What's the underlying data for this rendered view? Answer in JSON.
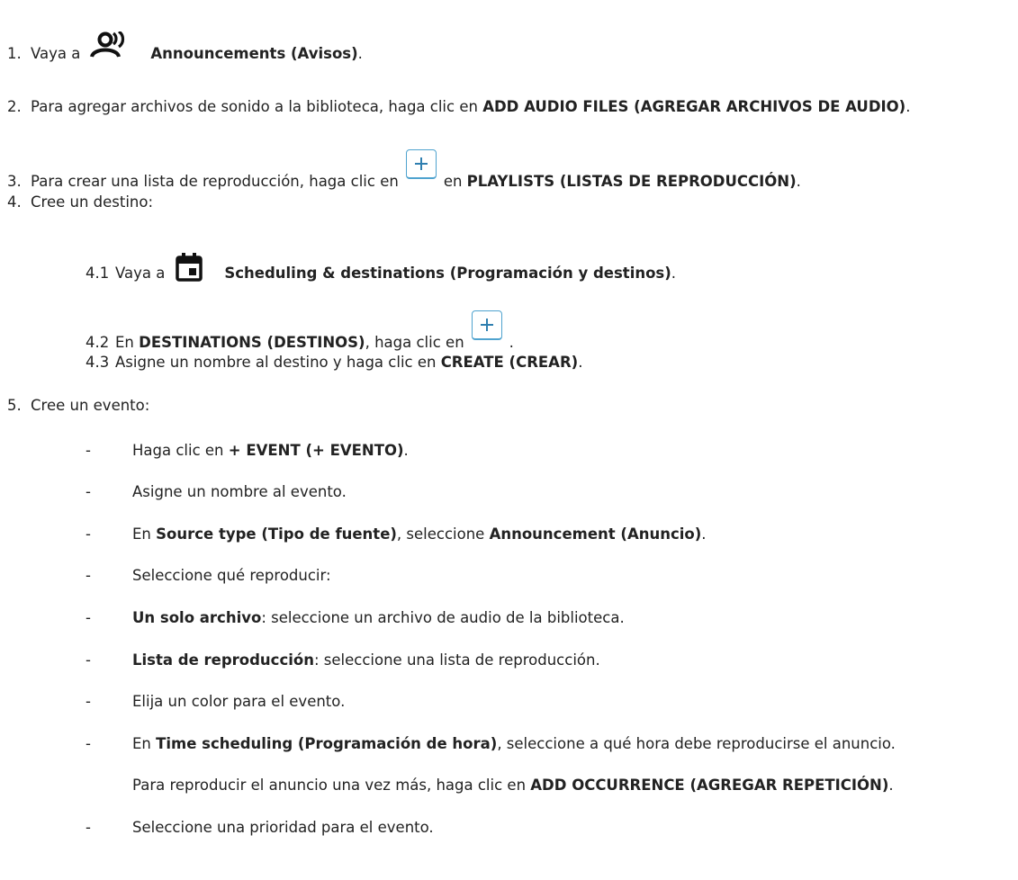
{
  "steps": {
    "s1": {
      "num": "1.",
      "pre": "Vaya a",
      "bold": "Announcements (Avisos)",
      "post": "."
    },
    "s2": {
      "num": "2.",
      "pre": "Para agregar archivos de sonido a la biblioteca, haga clic en ",
      "bold": "ADD AUDIO FILES (AGREGAR ARCHIVOS DE AUDIO)",
      "post": "."
    },
    "s3": {
      "num": "3.",
      "pre": "Para crear una lista de reproducción, haga clic en",
      "mid": "en ",
      "bold": "PLAYLISTS (LISTAS DE REPRODUCCIÓN)",
      "post": "."
    },
    "s4": {
      "num": "4.",
      "text": "Cree un destino:"
    },
    "s4_1": {
      "num": "4.1",
      "pre": "Vaya a",
      "bold": "Scheduling & destinations (Programación y destinos)",
      "post": "."
    },
    "s4_2": {
      "num": "4.2",
      "pre": "En ",
      "bold": "DESTINATIONS (DESTINOS)",
      "mid": ", haga clic en",
      "post": "."
    },
    "s4_3": {
      "num": "4.3",
      "pre": "Asigne un nombre al destino y haga clic en ",
      "bold": "CREATE (CREAR)",
      "post": "."
    },
    "s5": {
      "num": "5.",
      "text": "Cree un evento:"
    }
  },
  "bullets": {
    "dash": "-",
    "b1": {
      "pre": "Haga clic en ",
      "bold": "+ EVENT (+ EVENTO)",
      "post": "."
    },
    "b2": {
      "text": "Asigne un nombre al evento."
    },
    "b3": {
      "pre": "En ",
      "bold1": "Source type (Tipo de fuente)",
      "mid": ", seleccione ",
      "bold2": "Announcement (Anuncio)",
      "post": "."
    },
    "b4": {
      "text": "Seleccione qué reproducir:"
    },
    "b5": {
      "bold": "Un solo archivo",
      "post": ": seleccione un archivo de audio de la biblioteca."
    },
    "b6": {
      "bold": "Lista de reproducción",
      "post": ": seleccione una lista de reproducción."
    },
    "b7": {
      "text": "Elija un color para el evento."
    },
    "b8": {
      "pre": "En ",
      "bold": "Time scheduling (Programación de hora)",
      "post": ", seleccione a qué hora debe reproducirse el anuncio."
    },
    "b8_cont": {
      "pre": "Para reproducir el anuncio una vez más, haga clic en ",
      "bold": "ADD OCCURRENCE (AGREGAR REPETICIÓN)",
      "post": "."
    },
    "b9": {
      "text": "Seleccione una prioridad para el evento."
    }
  },
  "icons": {
    "announcements": "announcements-icon",
    "calendar": "calendar-icon",
    "add": "add-plus-icon"
  },
  "colors": {
    "button_border": "#4fa3cf",
    "plus": "#2f7fb0"
  }
}
